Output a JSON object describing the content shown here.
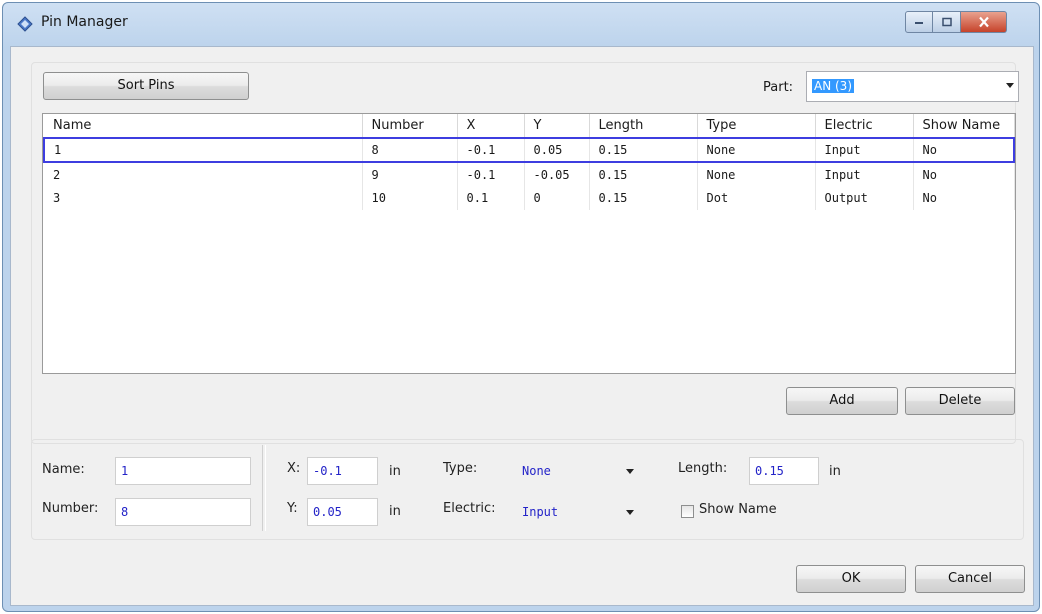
{
  "window": {
    "title": "Pin Manager",
    "app_icon": "diamond-logo-icon"
  },
  "toolbar": {
    "sort_label": "Sort Pins"
  },
  "part": {
    "label": "Part:",
    "value": "AN (3)"
  },
  "grid": {
    "columns": [
      "Name",
      "Number",
      "X",
      "Y",
      "Length",
      "Type",
      "Electric",
      "Show Name"
    ],
    "rows": [
      [
        "1",
        "8",
        "-0.1",
        "0.05",
        "0.15",
        "None",
        "Input",
        "No"
      ],
      [
        "2",
        "9",
        "-0.1",
        "-0.05",
        "0.15",
        "None",
        "Input",
        "No"
      ],
      [
        "3",
        "10",
        "0.1",
        "0",
        "0.15",
        "Dot",
        "Output",
        "No"
      ]
    ],
    "selected_row": 0
  },
  "actions": {
    "add_label": "Add",
    "delete_label": "Delete"
  },
  "editor": {
    "name_label": "Name:",
    "name_value": "1",
    "number_label": "Number:",
    "number_value": "8",
    "x_label": "X:",
    "x_value": "-0.1",
    "y_label": "Y:",
    "y_value": "0.05",
    "unit": "in",
    "type_label": "Type:",
    "type_value": "None",
    "electric_label": "Electric:",
    "electric_value": "Input",
    "length_label": "Length:",
    "length_value": "0.15",
    "show_name_label": "Show Name",
    "show_name_checked": false
  },
  "footer": {
    "ok_label": "OK",
    "cancel_label": "Cancel"
  },
  "colors": {
    "selection": "#3d3de0",
    "value_text": "#2323c8",
    "highlight": "#3399ff",
    "close_button": "#c6432b"
  }
}
